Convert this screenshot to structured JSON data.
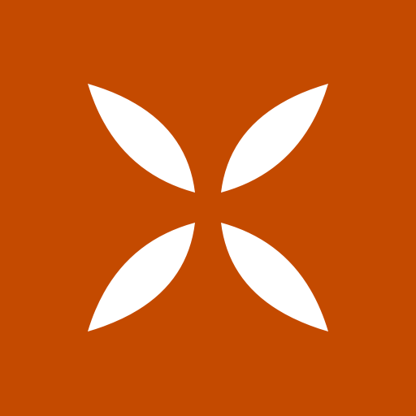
{
  "colors": {
    "background": "#c44a00",
    "petal": "#ffffff"
  },
  "icon": {
    "name": "four-petal-cross-icon",
    "petals": [
      "top-left",
      "top-right",
      "bottom-left",
      "bottom-right"
    ]
  }
}
